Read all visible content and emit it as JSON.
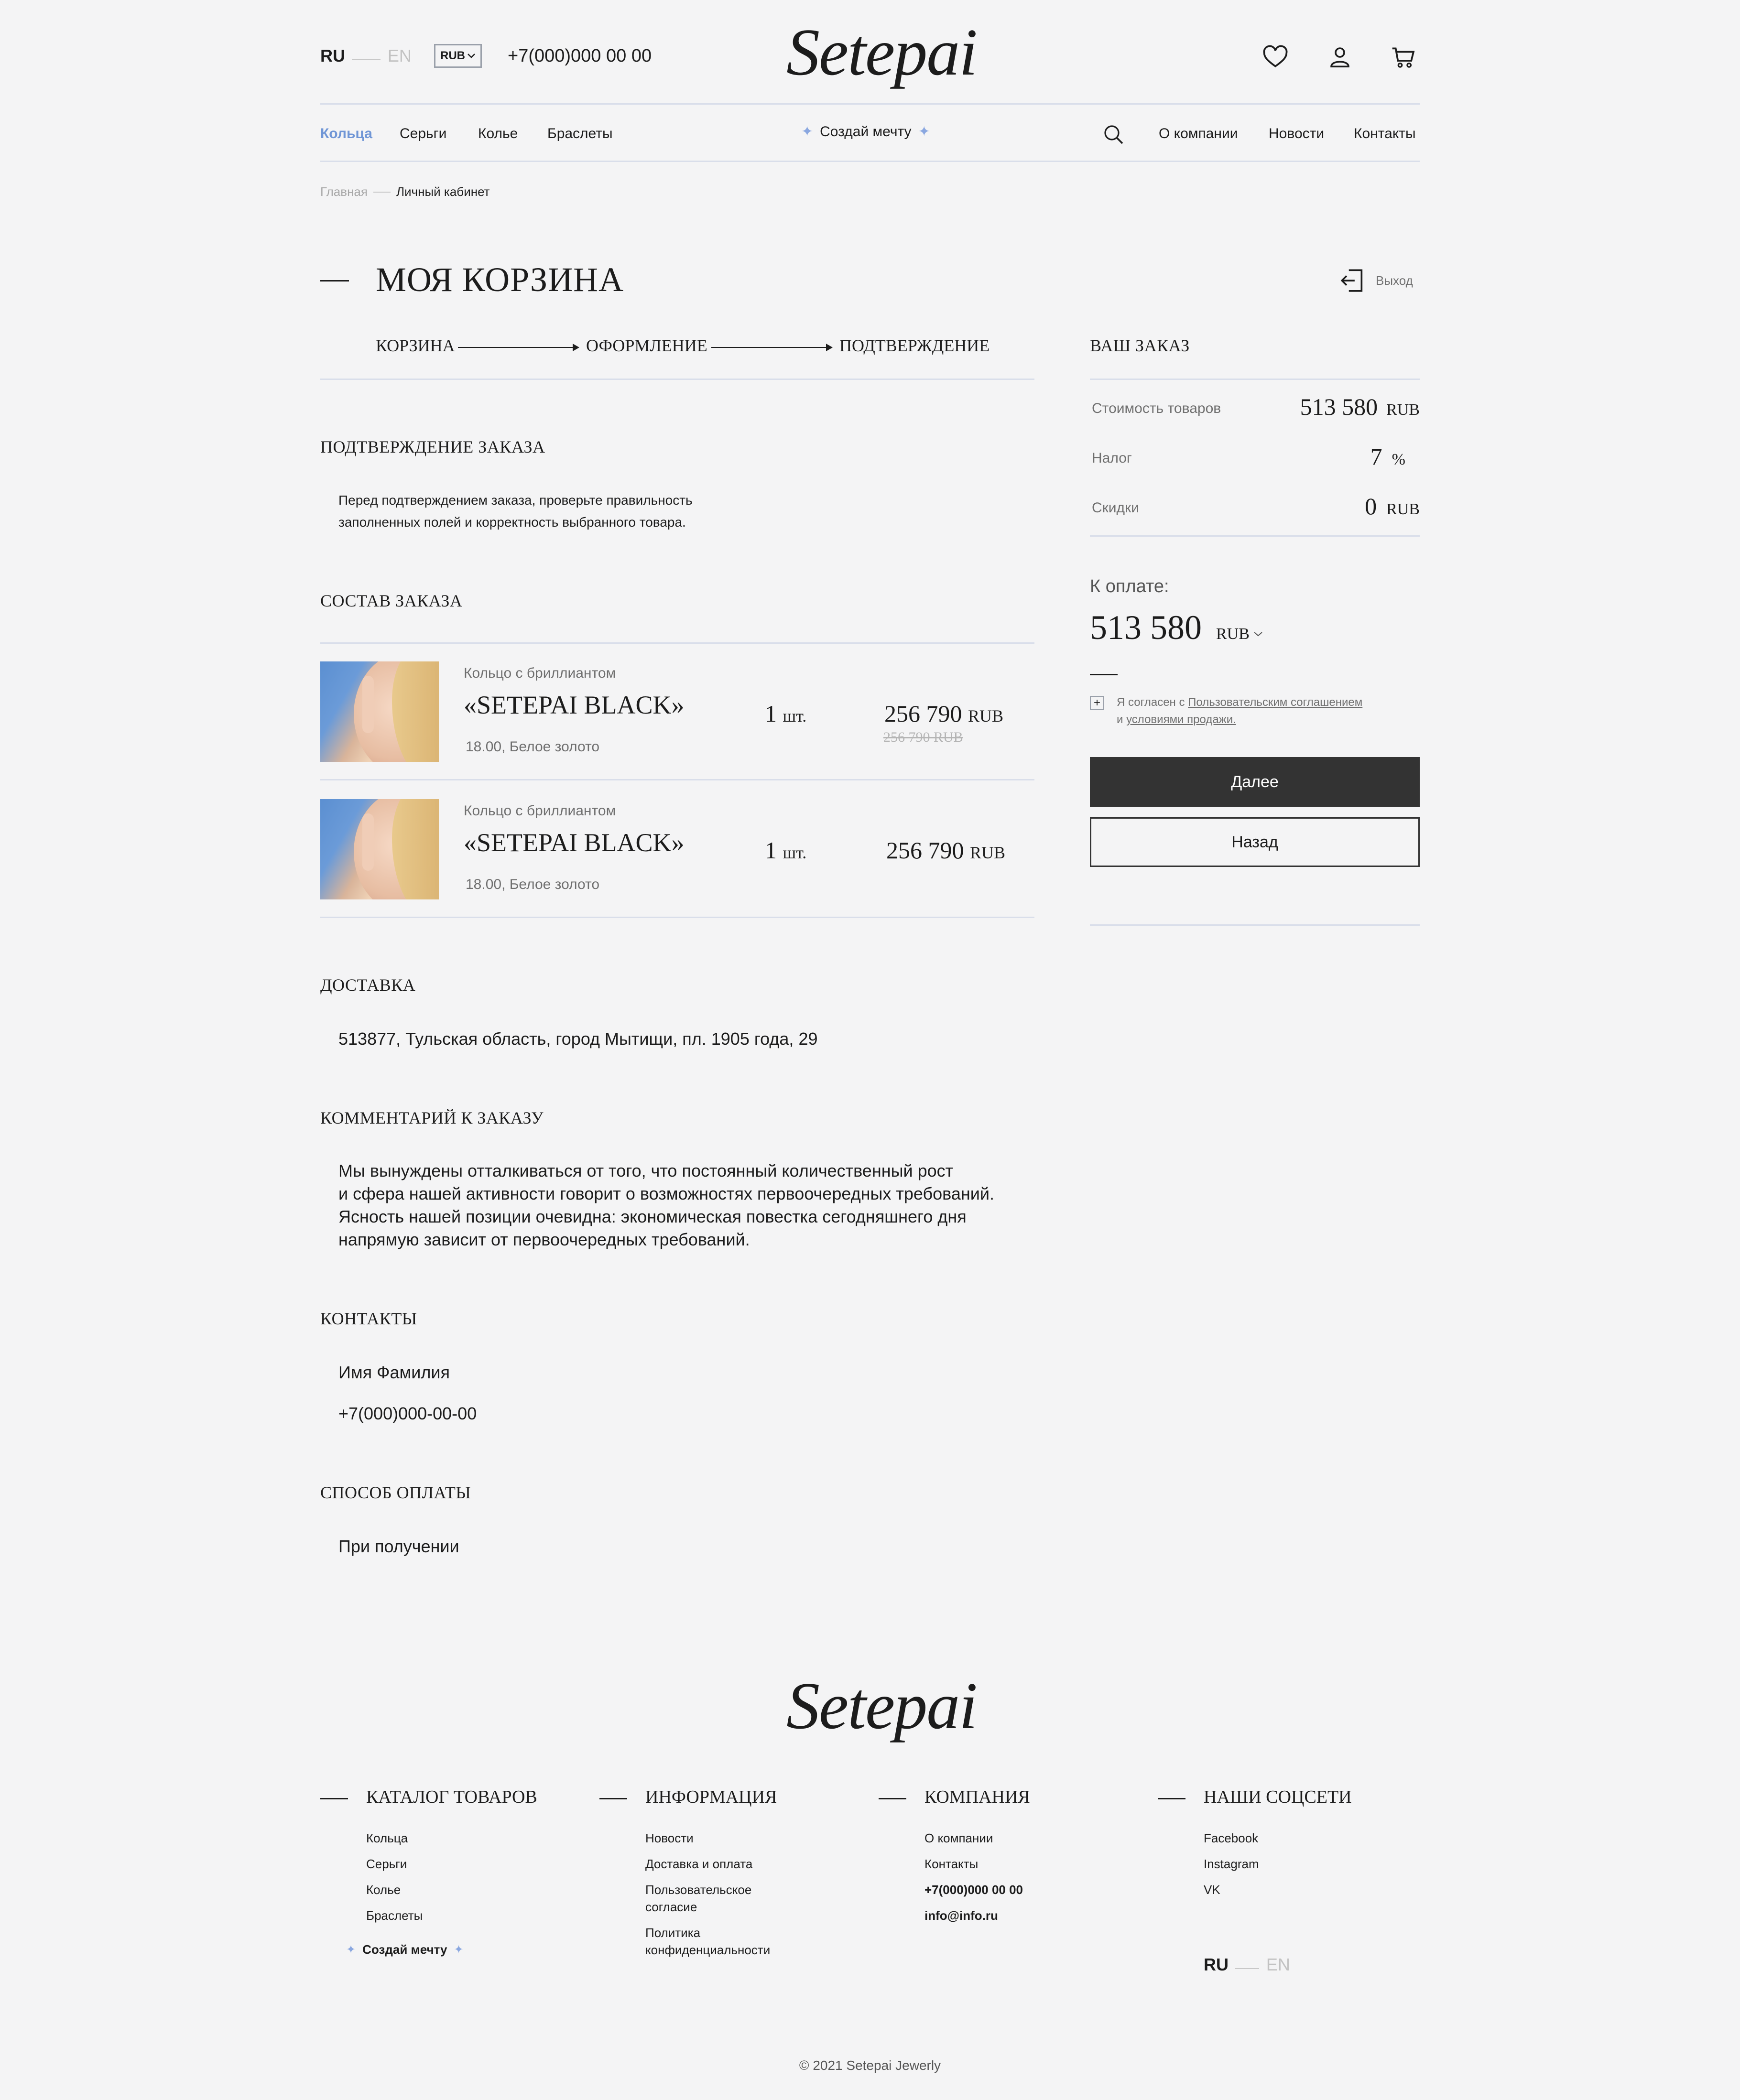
{
  "header": {
    "lang_active": "RU",
    "lang_inactive": "EN",
    "currency": "RUB",
    "phone": "+7(000)000 00 00",
    "logo": "Setepai"
  },
  "nav": {
    "left": [
      "Кольца",
      "Серьги",
      "Колье",
      "Браслеты"
    ],
    "center": "Создай мечту",
    "right": [
      "О компании",
      "Новости",
      "Контакты"
    ]
  },
  "breadcrumb": {
    "home": "Главная",
    "current": "Личный кабинет"
  },
  "page": {
    "title": "МОЯ КОРЗИНА",
    "logout": "Выход",
    "steps": [
      "КОРЗИНА",
      "ОФОРМЛЕНИЕ",
      "ПОДТВЕРЖДЕНИЕ"
    ]
  },
  "confirm": {
    "heading": "ПОДТВЕРЖДЕНИЕ ЗАКАЗА",
    "line1": "Перед подтверждением заказа, проверьте правильность",
    "line2": "заполненных полей и корректность выбранного товара."
  },
  "order": {
    "heading": "СОСТАВ ЗАКАЗА",
    "items": [
      {
        "subtitle": "Кольцо с бриллиантом",
        "name": "«SETEPAI BLACK»",
        "meta": "18.00, Белое золото",
        "qty": "1",
        "qty_unit": "шт.",
        "price": "256 790",
        "currency": "RUB",
        "old_price": "256 790 RUB"
      },
      {
        "subtitle": "Кольцо с бриллиантом",
        "name": "«SETEPAI BLACK»",
        "meta": "18.00, Белое золото",
        "qty": "1",
        "qty_unit": "шт.",
        "price": "256 790",
        "currency": "RUB"
      }
    ]
  },
  "delivery": {
    "heading": "ДОСТАВКА",
    "address": "513877, Тульская область, город Мытищи, пл. 1905 года, 29"
  },
  "comment": {
    "heading": "КОММЕНТАРИЙ К ЗАКАЗУ",
    "lines": [
      "Мы вынуждены отталкиваться от того, что постоянный количественный рост",
      "и сфера нашей активности говорит о возможностях первоочередных требований.",
      "Ясность нашей позиции очевидна: экономическая повестка сегодняшнего дня",
      "напрямую зависит от первоочередных требований."
    ]
  },
  "contacts": {
    "heading": "КОНТАКТЫ",
    "name": "Имя Фамилия",
    "phone": "+7(000)000-00-00"
  },
  "payment": {
    "heading": "СПОСОБ ОПЛАТЫ",
    "method": "При получении"
  },
  "summary": {
    "heading": "ВАШ ЗАКАЗ",
    "goods_label": "Стоимость товаров",
    "goods_value": "513 580",
    "goods_unit": "RUB",
    "tax_label": "Налог",
    "tax_value": "7",
    "tax_unit": "%",
    "discount_label": "Скидки",
    "discount_value": "0",
    "discount_unit": "RUB",
    "to_pay_label": "К оплате:",
    "to_pay_value": "513 580",
    "to_pay_unit": "RUB",
    "agree_prefix": "Я согласен с ",
    "agree_link1": "Пользовательским соглашением",
    "agree_mid": "и ",
    "agree_link2": "условиями продажи.",
    "next_button": "Далее",
    "back_button": "Назад"
  },
  "footer": {
    "logo": "Setepai",
    "catalog": {
      "heading": "КАТАЛОГ ТОВАРОВ",
      "links": [
        "Кольца",
        "Серьги",
        "Колье",
        "Браслеты"
      ],
      "dream": "Создай мечту"
    },
    "info": {
      "heading": "ИНФОРМАЦИЯ",
      "links": [
        "Новости",
        "Доставка и оплата",
        "Пользовательское согласие",
        "Политика конфиденциальности"
      ]
    },
    "company": {
      "heading": "КОМПАНИЯ",
      "links": [
        "О компании",
        "Контакты"
      ],
      "phone": "+7(000)000 00 00",
      "email": "info@info.ru"
    },
    "social": {
      "heading": "НАШИ СОЦСЕТИ",
      "links": [
        "Facebook",
        "Instagram",
        "VK"
      ]
    },
    "lang_active": "RU",
    "lang_inactive": "EN",
    "copyright": "© 2021 Setepai Jewerly"
  }
}
